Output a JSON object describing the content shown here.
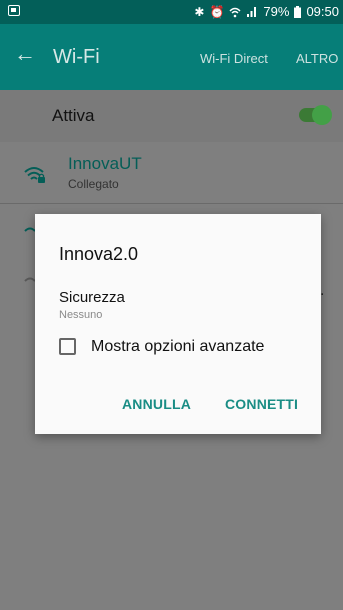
{
  "status_bar": {
    "battery_percent": "79%",
    "time": "09:50",
    "icons": [
      "screenshot-icon",
      "bluetooth-icon",
      "alarm-icon",
      "wifi-signal-icon",
      "cell-signal-icon",
      "battery-icon"
    ]
  },
  "app_bar": {
    "title": "Wi-Fi",
    "action_wifi_direct": "Wi-Fi Direct",
    "action_more": "ALTRO"
  },
  "toggle_row": {
    "label": "Attiva",
    "enabled": true,
    "accent_color": "#43a047"
  },
  "networks": [
    {
      "name": "InnovaUT",
      "status": "Collegato",
      "secured": true
    }
  ],
  "dialog": {
    "title": "Innova2.0",
    "security_label": "Sicurezza",
    "security_value": "Nessuno",
    "checkbox_label": "Mostra opzioni avanzate",
    "checkbox_checked": false,
    "cancel_label": "ANNULLA",
    "connect_label": "CONNETTI",
    "accent_color": "#1a8d85"
  },
  "theme": {
    "status_bar_color": "#035f59",
    "app_bar_color": "#067e78"
  }
}
